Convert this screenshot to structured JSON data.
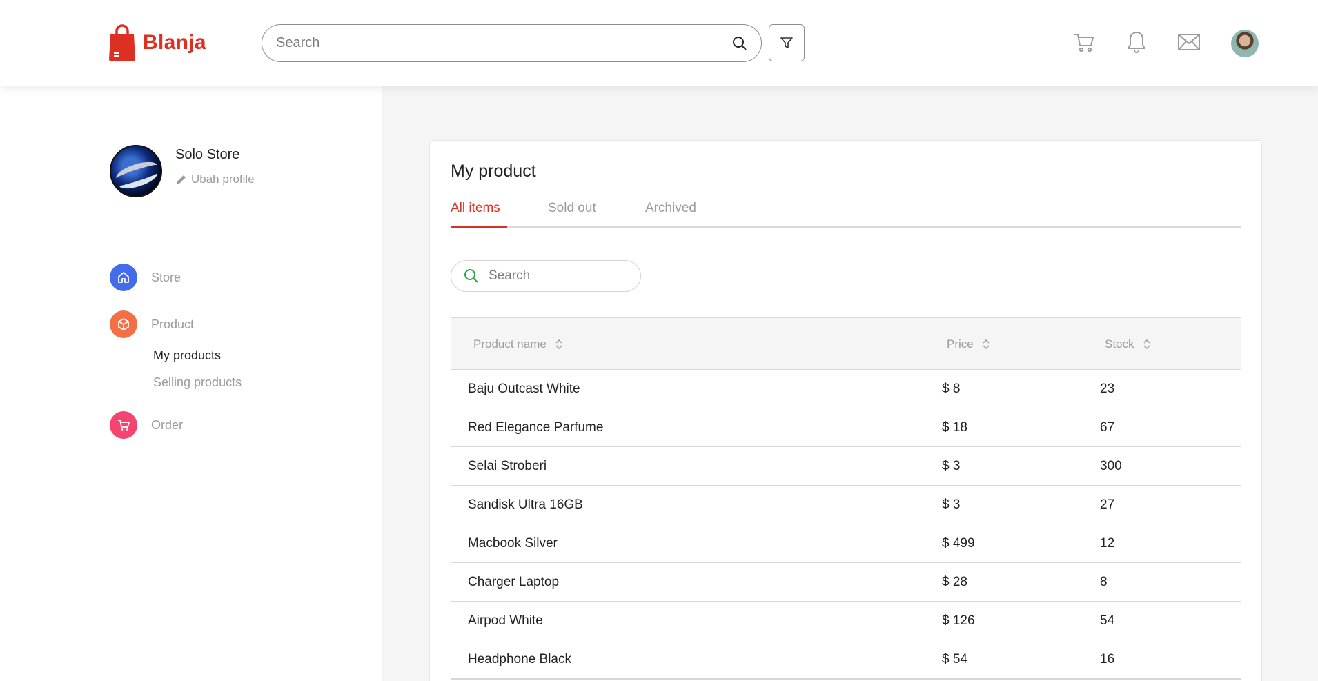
{
  "header": {
    "brand": "Blanja",
    "search_placeholder": "Search",
    "icons": [
      "shopping-bag-icon",
      "search-icon",
      "filter-icon",
      "cart-icon",
      "bell-icon",
      "mail-icon"
    ],
    "brand_color": "#db3022"
  },
  "sidebar": {
    "store_name": "Solo Store",
    "edit_profile": "Ubah profile",
    "nav": [
      {
        "label": "Store",
        "icon": "home-icon",
        "color": "#456bed"
      },
      {
        "label": "Product",
        "icon": "box-icon",
        "color": "#f36f45"
      },
      {
        "label": "Order",
        "icon": "cart-icon",
        "color": "#f3456f"
      }
    ],
    "product_sub": [
      {
        "label": "My products",
        "active": true
      },
      {
        "label": "Selling products",
        "active": false
      }
    ]
  },
  "main": {
    "title": "My product",
    "tabs": [
      {
        "label": "All items",
        "active": true
      },
      {
        "label": "Sold out",
        "active": false
      },
      {
        "label": "Archived",
        "active": false
      }
    ],
    "search_placeholder": "Search",
    "table": {
      "columns": [
        "Product name",
        "Price",
        "Stock"
      ],
      "rows": [
        {
          "name": "Baju Outcast White",
          "price": "$ 8",
          "stock": "23"
        },
        {
          "name": "Red Elegance Parfume",
          "price": "$ 18",
          "stock": "67"
        },
        {
          "name": "Selai Stroberi",
          "price": "$ 3",
          "stock": "300"
        },
        {
          "name": "Sandisk Ultra 16GB",
          "price": "$ 3",
          "stock": "27"
        },
        {
          "name": "Macbook Silver",
          "price": "$ 499",
          "stock": "12"
        },
        {
          "name": "Charger Laptop",
          "price": "$ 28",
          "stock": "8"
        },
        {
          "name": "Airpod White",
          "price": "$ 126",
          "stock": "54"
        },
        {
          "name": "Headphone Black",
          "price": "$ 54",
          "stock": "16"
        }
      ]
    }
  }
}
